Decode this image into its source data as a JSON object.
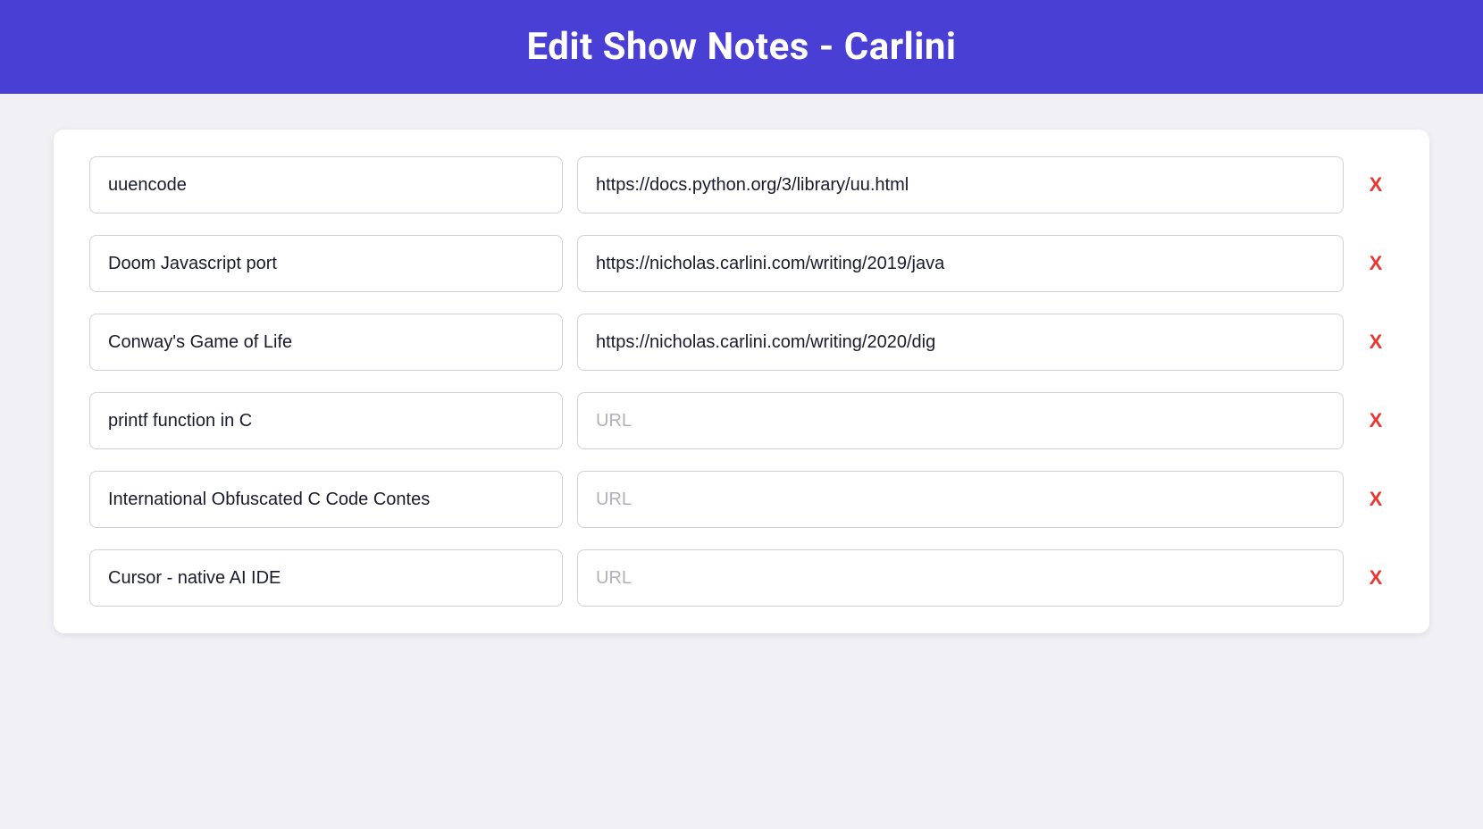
{
  "header": {
    "title": "Edit Show Notes - Carlini"
  },
  "colors": {
    "header_bg": "#4a3fd4",
    "delete_color": "#e53935"
  },
  "rows": [
    {
      "id": 1,
      "name_value": "uuencode",
      "url_value": "https://docs.python.org/3/library/uu.html",
      "url_placeholder": "URL"
    },
    {
      "id": 2,
      "name_value": "Doom Javascript port",
      "url_value": "https://nicholas.carlini.com/writing/2019/java",
      "url_placeholder": "URL"
    },
    {
      "id": 3,
      "name_value": "Conway's Game of Life",
      "url_value": "https://nicholas.carlini.com/writing/2020/dig",
      "url_placeholder": "URL"
    },
    {
      "id": 4,
      "name_value": "printf function in C",
      "url_value": "",
      "url_placeholder": "URL"
    },
    {
      "id": 5,
      "name_value": "International Obfuscated C Code Contes",
      "url_value": "",
      "url_placeholder": "URL"
    },
    {
      "id": 6,
      "name_value": "Cursor - native AI IDE",
      "url_value": "",
      "url_placeholder": "URL"
    }
  ],
  "delete_label": "X"
}
